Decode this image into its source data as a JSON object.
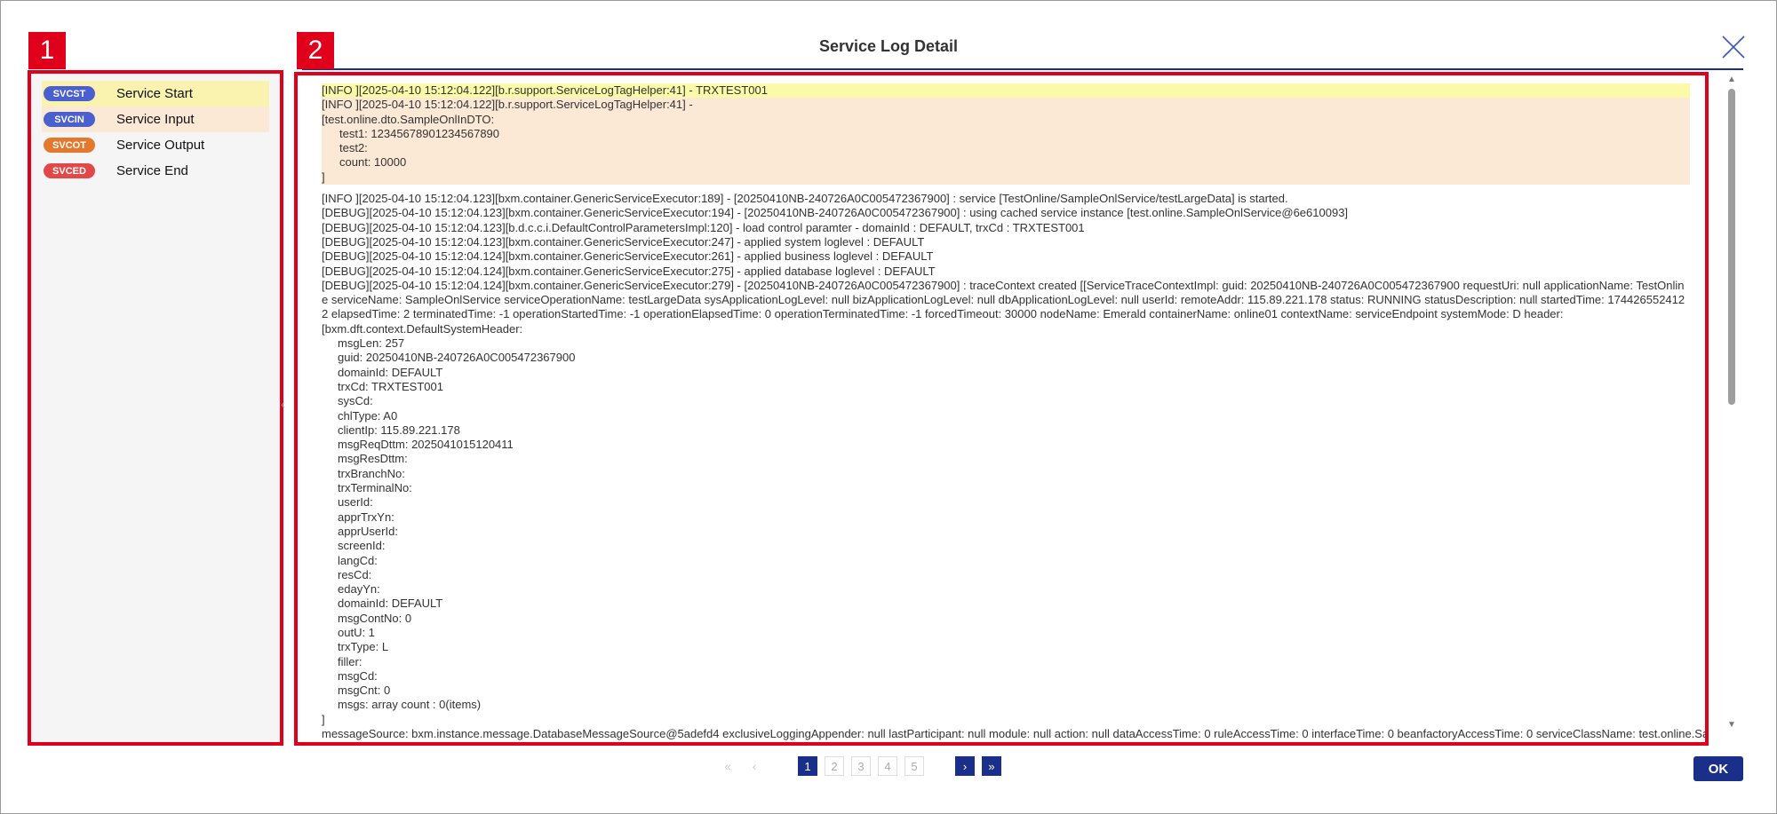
{
  "dialog": {
    "title": "Service Log Detail",
    "close_icon": "close-icon",
    "marker_1": "1",
    "marker_2": "2",
    "splitter_glyph": "‹"
  },
  "tags": [
    {
      "code": "SVCST",
      "label": "Service Start",
      "color": "#4a5fd0",
      "selected": true
    },
    {
      "code": "SVCIN",
      "label": "Service Input",
      "color": "#4a5fd0"
    },
    {
      "code": "SVCOT",
      "label": "Service Output",
      "color": "#e4782c"
    },
    {
      "code": "SVCED",
      "label": "Service End",
      "color": "#e24848"
    }
  ],
  "log": {
    "start_line": "[INFO ][2025-04-10 15:12:04.122][b.r.support.ServiceLogTagHelper:41] - TRXTEST001",
    "input_lines": [
      "[INFO ][2025-04-10 15:12:04.122][b.r.support.ServiceLogTagHelper:41] -",
      "[test.online.dto.SampleOnlInDTO:",
      "test1: 12345678901234567890",
      "test2:",
      "count: 10000",
      "]"
    ],
    "lines": [
      "[INFO ][2025-04-10 15:12:04.123][bxm.container.GenericServiceExecutor:189] - [20250410NB-240726A0C005472367900] : service [TestOnline/SampleOnlService/testLargeData] is started.",
      "[DEBUG][2025-04-10 15:12:04.123][bxm.container.GenericServiceExecutor:194] - [20250410NB-240726A0C005472367900] : using cached service instance [test.online.SampleOnlService@6e610093]",
      "[DEBUG][2025-04-10 15:12:04.123][b.d.c.c.i.DefaultControlParametersImpl:120] - load control paramter - domainId : DEFAULT, trxCd : TRXTEST001",
      "[DEBUG][2025-04-10 15:12:04.123][bxm.container.GenericServiceExecutor:247] - applied system loglevel : DEFAULT",
      "[DEBUG][2025-04-10 15:12:04.124][bxm.container.GenericServiceExecutor:261] - applied business loglevel : DEFAULT",
      "[DEBUG][2025-04-10 15:12:04.124][bxm.container.GenericServiceExecutor:275] - applied database loglevel : DEFAULT"
    ],
    "trace_line": "[DEBUG][2025-04-10 15:12:04.124][bxm.container.GenericServiceExecutor:279] - [20250410NB-240726A0C005472367900] : traceContext created [[ServiceTraceContextImpl: guid: 20250410NB-240726A0C005472367900 requestUri: null applicationName: TestOnline serviceName: SampleOnlService serviceOperationName: testLargeData sysApplicationLogLevel: null bizApplicationLogLevel: null dbApplicationLogLevel: null userId:  remoteAddr: 115.89.221.178 status: RUNNING statusDescription: null startedTime: 1744265524122 elapsedTime: 2 terminatedTime: -1 operationStartedTime: -1 operationElapsedTime: 0 operationTerminatedTime: -1 forcedTimeout: 30000 nodeName: Emerald containerName: online01 contextName: serviceEndpoint systemMode: D header:",
    "header_open": "[bxm.dft.context.DefaultSystemHeader:",
    "header_fields": [
      "msgLen: 257",
      "guid: 20250410NB-240726A0C005472367900",
      "domainId: DEFAULT",
      "trxCd: TRXTEST001",
      "sysCd:",
      "chlType: A0",
      "clientIp: 115.89.221.178",
      "msgReqDttm: 2025041015120411",
      "msgResDttm:",
      "trxBranchNo:",
      "trxTerminalNo:",
      "userId:",
      "apprTrxYn:",
      "apprUserId:",
      "screenId:",
      "langCd:",
      "resCd:",
      "edayYn:",
      "domainId: DEFAULT",
      "msgContNo: 0",
      "outU: 1",
      "trxType: L",
      "filler:",
      "msgCd:",
      "msgCnt: 0",
      "msgs: array count : 0(items)"
    ],
    "header_close": "]",
    "message_source_line": "messageSource: bxm.instance.message.DatabaseMessageSource@5adefd4 exclusiveLoggingAppender: null lastParticipant: null module: null action: null dataAccessTime: 0 ruleAccessTime: 0 interfaceTime: 0 beanfactoryAccessTime: 0 serviceClassName: test.online.SampleOnl"
  },
  "pagination": {
    "first": "«",
    "prev": "‹",
    "pages": [
      "1",
      "2",
      "3",
      "4",
      "5"
    ],
    "next": "›",
    "last": "»"
  },
  "footer": {
    "ok_label": "OK"
  }
}
